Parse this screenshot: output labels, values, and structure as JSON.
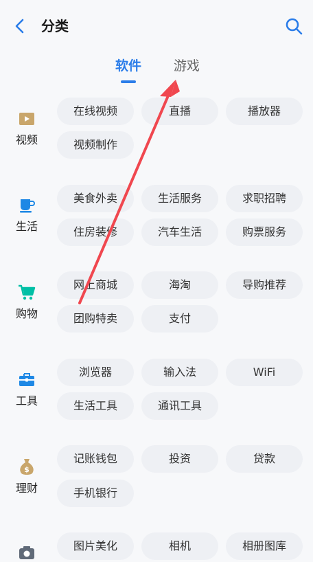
{
  "header": {
    "title": "分类"
  },
  "tabs": {
    "active": "软件",
    "inactive": "游戏"
  },
  "categories": [
    {
      "label": "视频",
      "items": [
        "在线视频",
        "直播",
        "播放器",
        "视频制作"
      ]
    },
    {
      "label": "生活",
      "items": [
        "美食外卖",
        "生活服务",
        "求职招聘",
        "住房装修",
        "汽车生活",
        "购票服务"
      ]
    },
    {
      "label": "购物",
      "items": [
        "网上商城",
        "海淘",
        "导购推荐",
        "团购特卖",
        "支付"
      ]
    },
    {
      "label": "工具",
      "items": [
        "浏览器",
        "输入法",
        "WiFi",
        "生活工具",
        "通讯工具"
      ]
    },
    {
      "label": "理财",
      "items": [
        "记账钱包",
        "投资",
        "贷款",
        "手机银行"
      ]
    },
    {
      "label": "",
      "items": [
        "图片美化",
        "相机",
        "相册图库"
      ]
    }
  ],
  "colors": {
    "accent": "#2b7de9",
    "arrow": "#f0474f",
    "video_icon": "#c9a66b",
    "life_icon": "#1e88e5",
    "shop_icon": "#00bfa5",
    "tool_icon": "#1e88e5",
    "finance_icon": "#c9a66b"
  }
}
